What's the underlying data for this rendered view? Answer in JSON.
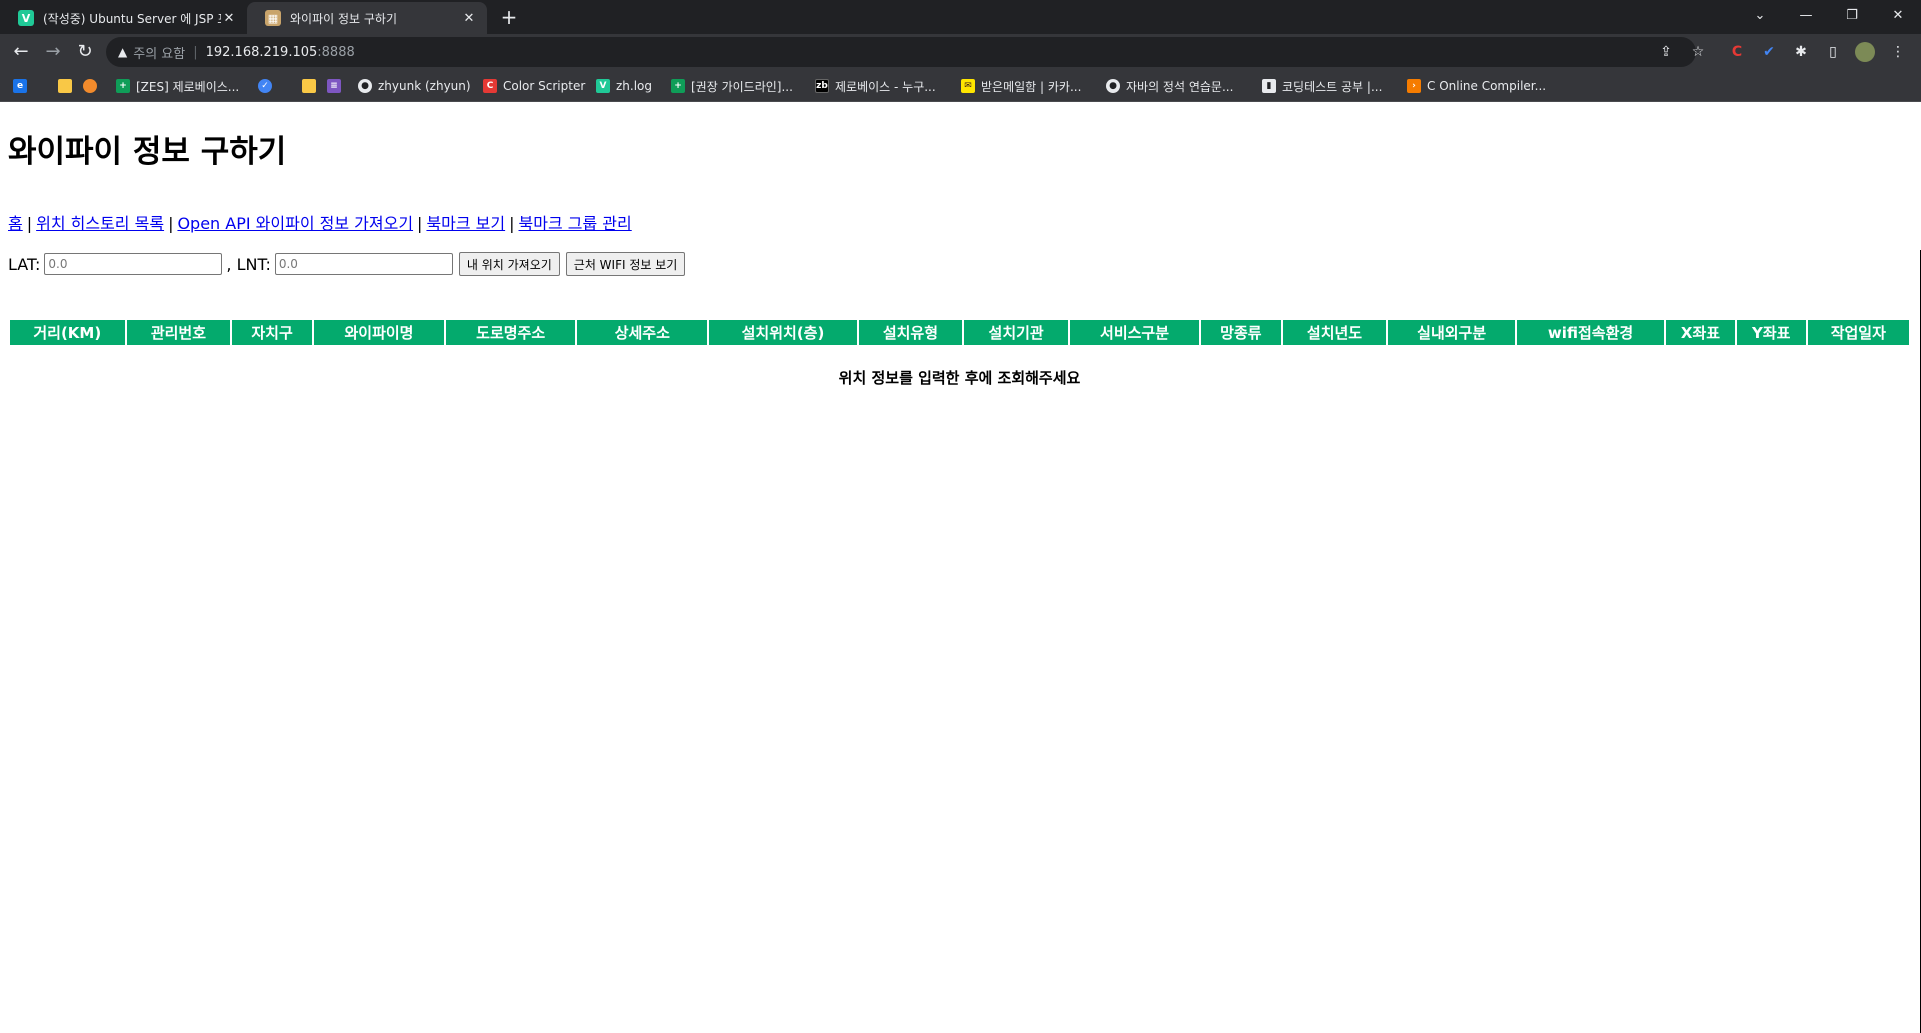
{
  "browser": {
    "tabs": [
      {
        "title": "(작성중) Ubuntu Server 에 JSP 프",
        "favicon": "velog-icon",
        "active": false
      },
      {
        "title": "와이파이 정보 구하기",
        "favicon": "page-icon",
        "active": true
      }
    ],
    "address": {
      "warning": "주의 요함",
      "host": "192.168.219.105",
      "port": ":8888"
    },
    "bookmarks": [
      {
        "label": "",
        "icon": "edge-icon",
        "color": "#1a73e8"
      },
      {
        "label": "",
        "icon": "folder-icon",
        "color": "#f9c846"
      },
      {
        "label": "",
        "icon": "emoji-icon",
        "color": "#f28b2c"
      },
      {
        "label": "[ZES] 제로베이스...",
        "icon": "zerobase-icon",
        "color": "#0f9d58"
      },
      {
        "label": "",
        "icon": "check-circle-icon",
        "color": "#4285f4"
      },
      {
        "label": "",
        "icon": "folder-icon",
        "color": "#f9c846"
      },
      {
        "label": "",
        "icon": "bars-icon",
        "color": "#7e57c2"
      },
      {
        "label": "zhyunk (zhyun)",
        "icon": "github-icon",
        "color": "#24292e"
      },
      {
        "label": "Color Scripter",
        "icon": "c-icon",
        "color": "#e53935"
      },
      {
        "label": "zh.log",
        "icon": "velog-icon",
        "color": "#20c997"
      },
      {
        "label": "[권장 가이드라인]...",
        "icon": "zerobase-icon",
        "color": "#0f9d58"
      },
      {
        "label": "제로베이스 - 누구...",
        "icon": "zb-icon",
        "color": "#000000"
      },
      {
        "label": "받은메일함 | 카카...",
        "icon": "mail-icon",
        "color": "#fee500"
      },
      {
        "label": "자바의 정석 연습문...",
        "icon": "github-icon",
        "color": "#24292e"
      },
      {
        "label": "코딩테스트 공부 |...",
        "icon": "bookmark-icon",
        "color": "#5f6368"
      },
      {
        "label": "C Online Compiler...",
        "icon": "compiler-icon",
        "color": "#f57c00"
      }
    ]
  },
  "page": {
    "title": "와이파이 정보 구하기",
    "nav": [
      "홈",
      "위치 히스토리 목록",
      "Open API 와이파이 정보 가져오기",
      "북마크 보기",
      "북마크 그룹 관리"
    ],
    "nav_separator": "|",
    "lat_label": "LAT:",
    "lat_placeholder": "0.0",
    "lnt_label": ", LNT:",
    "lnt_placeholder": "0.0",
    "my_location_button": "내 위치 가져오기",
    "nearby_wifi_button": "근처 WIFI 정보 보기",
    "table_headers": [
      "거리(KM)",
      "관리번호",
      "자치구",
      "와이파이명",
      "도로명주소",
      "상세주소",
      "설치위치(층)",
      "설치유형",
      "설치기관",
      "서비스구분",
      "망종류",
      "설치년도",
      "실내외구분",
      "wifi접속환경",
      "X좌표",
      "Y좌표",
      "작업일자"
    ],
    "empty_message": "위치 정보를 입력한 후에 조회해주세요",
    "header_color": "#04aa6d"
  }
}
